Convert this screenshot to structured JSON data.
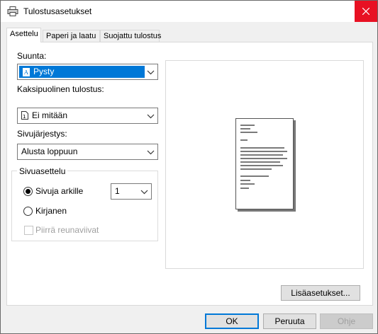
{
  "window": {
    "title": "Tulostusasetukset"
  },
  "tabs": [
    {
      "label": "Asettelu"
    },
    {
      "label": "Paperi ja laatu"
    },
    {
      "label": "Suojattu tulostus"
    }
  ],
  "orientation": {
    "label": "Suunta:",
    "value": "Pysty"
  },
  "duplex": {
    "label": "Kaksipuolinen tulostus:",
    "value": "Ei mitään"
  },
  "page_order": {
    "label": "Sivujärjestys:",
    "value": "Alusta loppuun"
  },
  "page_format": {
    "group_label": "Sivuasettelu",
    "pages_per_sheet_label": "Sivuja arkille",
    "pages_per_sheet_value": "1",
    "booklet_label": "Kirjanen",
    "draw_borders_label": "Piirrä reunaviivat",
    "selected": "pages_per_sheet"
  },
  "buttons": {
    "advanced": "Lisäasetukset...",
    "ok": "OK",
    "cancel": "Peruuta",
    "help": "Ohje"
  },
  "colors": {
    "accent": "#0078d7",
    "close": "#e81123"
  }
}
